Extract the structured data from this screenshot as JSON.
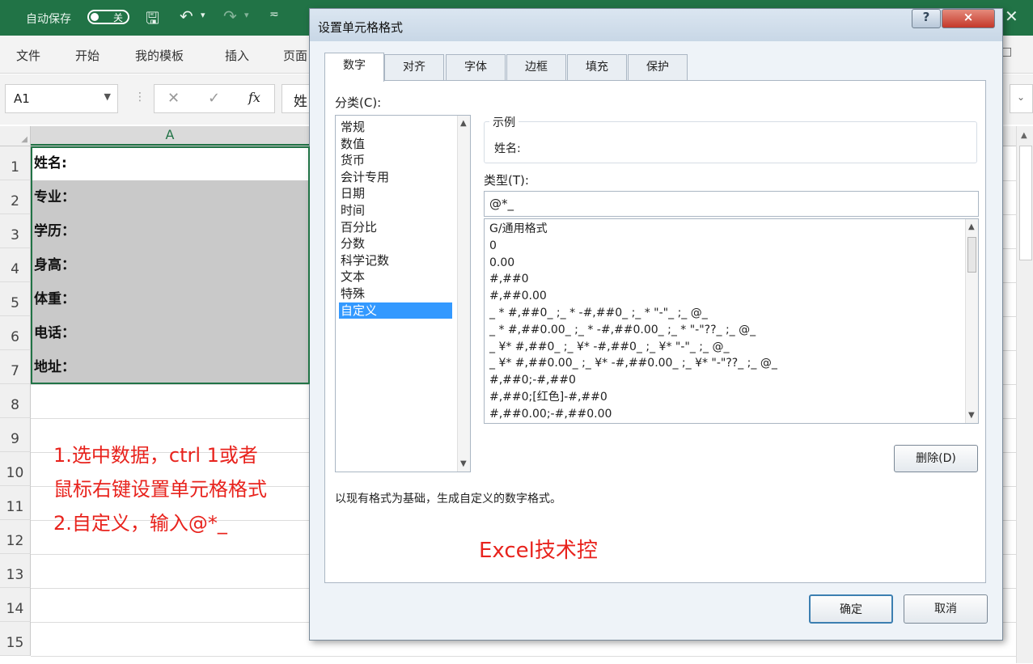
{
  "excel": {
    "autosave_label": "自动保存",
    "autosave_state": "关",
    "ribbon_tabs": [
      "文件",
      "开始",
      "我的模板",
      "插入",
      "页面"
    ],
    "name_box": "A1",
    "formula_partial": "姓",
    "column_header": "A",
    "row_numbers": [
      "1",
      "2",
      "3",
      "4",
      "5",
      "6",
      "7",
      "8",
      "9",
      "10",
      "11",
      "12",
      "13",
      "14",
      "15"
    ],
    "cells": [
      "姓名:",
      "专业：",
      "学历：",
      "身高：",
      "体重：",
      "电话：",
      "地址："
    ],
    "annotation_lines": [
      "1.选中数据，ctrl 1或者",
      "鼠标右键设置单元格格式",
      "2.自定义，输入@*_"
    ]
  },
  "dialog": {
    "title": "设置单元格格式",
    "help_button": "?",
    "close_button": "×",
    "tabs": [
      "数字",
      "对齐",
      "字体",
      "边框",
      "填充",
      "保护"
    ],
    "active_tab": "数字",
    "category_label": "分类(C):",
    "categories": [
      "常规",
      "数值",
      "货币",
      "会计专用",
      "日期",
      "时间",
      "百分比",
      "分数",
      "科学记数",
      "文本",
      "特殊",
      "自定义"
    ],
    "selected_category": "自定义",
    "sample_label": "示例",
    "sample_value": "姓名:",
    "type_label": "类型(T):",
    "type_value": "@*_",
    "type_list": [
      "G/通用格式",
      "0",
      "0.00",
      "#,##0",
      "#,##0.00",
      "_ * #,##0_ ;_ * -#,##0_ ;_ * \"-\"_ ;_ @_",
      "_ * #,##0.00_ ;_ * -#,##0.00_ ;_ * \"-\"??_ ;_ @_",
      "_ ¥* #,##0_ ;_ ¥* -#,##0_ ;_ ¥* \"-\"_ ;_ @_",
      "_ ¥* #,##0.00_ ;_ ¥* -#,##0.00_ ;_ ¥* \"-\"??_ ;_ @_",
      "#,##0;-#,##0",
      "#,##0;[红色]-#,##0",
      "#,##0.00;-#,##0.00"
    ],
    "delete_button": "删除(D)",
    "description": "以现有格式为基础，生成自定义的数字格式。",
    "watermark": "Excel技术控",
    "ok_button": "确定",
    "cancel_button": "取消"
  },
  "colors": {
    "excel_green": "#217346",
    "selection_blue": "#3399ff",
    "annotation_red": "#e8231d"
  }
}
